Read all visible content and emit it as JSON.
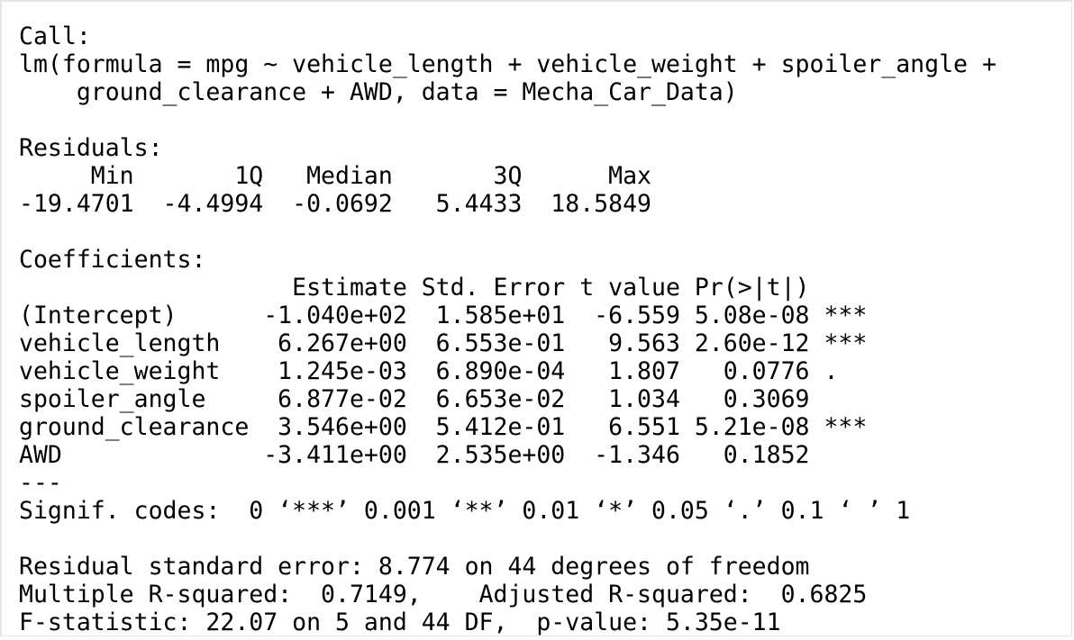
{
  "console": {
    "lines": [
      "Call:",
      "lm(formula = mpg ~ vehicle_length + vehicle_weight + spoiler_angle + ",
      "    ground_clearance + AWD, data = Mecha_Car_Data)",
      "",
      "Residuals:",
      "     Min       1Q   Median       3Q      Max ",
      "-19.4701  -4.4994  -0.0692   5.4433  18.5849 ",
      "",
      "Coefficients:",
      "                   Estimate Std. Error t value Pr(>|t|)    ",
      "(Intercept)      -1.040e+02  1.585e+01  -6.559 5.08e-08 ***",
      "vehicle_length    6.267e+00  6.553e-01   9.563 2.60e-12 ***",
      "vehicle_weight    1.245e-03  6.890e-04   1.807   0.0776 .  ",
      "spoiler_angle     6.877e-02  6.653e-02   1.034   0.3069    ",
      "ground_clearance  3.546e+00  5.412e-01   6.551 5.21e-08 ***",
      "AWD              -3.411e+00  2.535e+00  -1.346   0.1852    ",
      "---",
      "Signif. codes:  0 ‘***’ 0.001 ‘**’ 0.01 ‘*’ 0.05 ‘.’ 0.1 ‘ ’ 1",
      "",
      "Residual standard error: 8.774 on 44 degrees of freedom",
      "Multiple R-squared:  0.7149,\tAdjusted R-squared:  0.6825 ",
      "F-statistic: 22.07 on 5 and 44 DF,  p-value: 5.35e-11"
    ]
  }
}
